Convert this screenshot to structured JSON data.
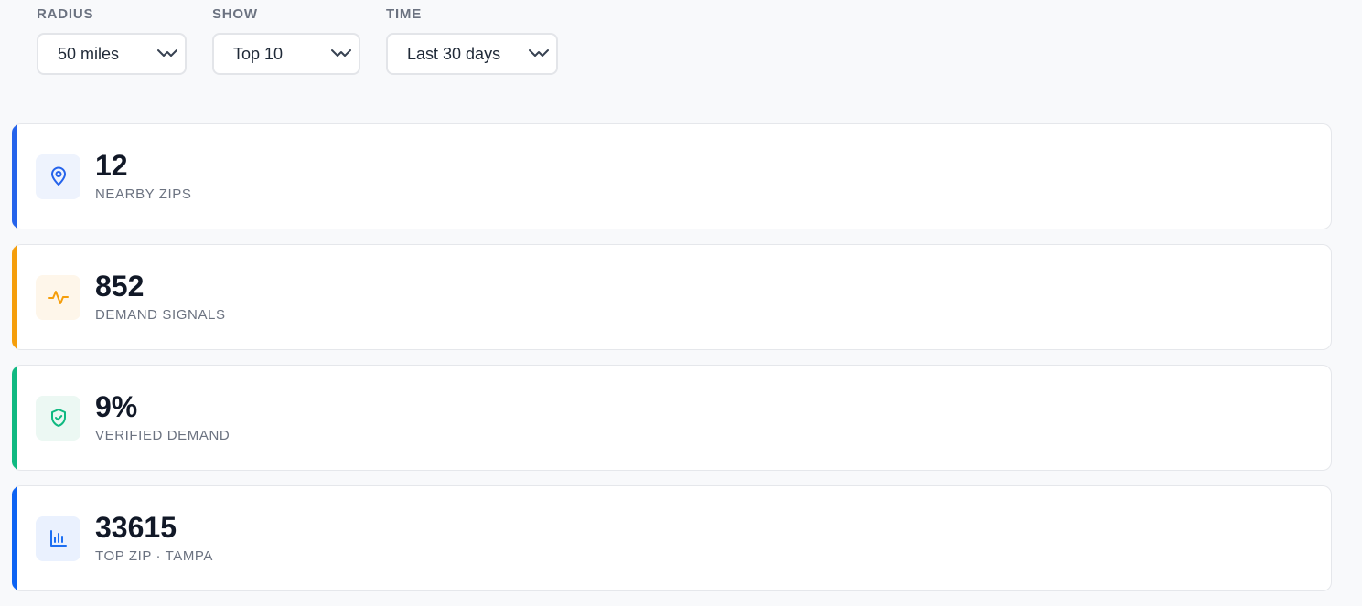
{
  "filters": [
    {
      "label": "RADIUS",
      "value": "50 miles",
      "width": 164
    },
    {
      "label": "SHOW",
      "value": "Top 10",
      "width": 162
    },
    {
      "label": "TIME",
      "value": "Last 30 days",
      "width": 188
    }
  ],
  "cards": [
    {
      "value": "12",
      "label": "NEARBY ZIPS",
      "icon": "map-pin-icon",
      "accent": "#2563eb",
      "icon_bg": "#eef3fd",
      "icon_color": "#2563eb"
    },
    {
      "value": "852",
      "label": "DEMAND SIGNALS",
      "icon": "activity-icon",
      "accent": "#f59e0b",
      "icon_bg": "#fef6ea",
      "icon_color": "#f59e0b"
    },
    {
      "value": "9%",
      "label": "VERIFIED DEMAND",
      "icon": "shield-check-icon",
      "accent": "#10b981",
      "icon_bg": "#ecf8f3",
      "icon_color": "#10b981"
    },
    {
      "value": "33615",
      "label": "TOP ZIP · TAMPA",
      "icon": "bar-chart-icon",
      "accent": "#0d63f3",
      "icon_bg": "#eaf1fe",
      "icon_color": "#1d6ff2"
    }
  ]
}
